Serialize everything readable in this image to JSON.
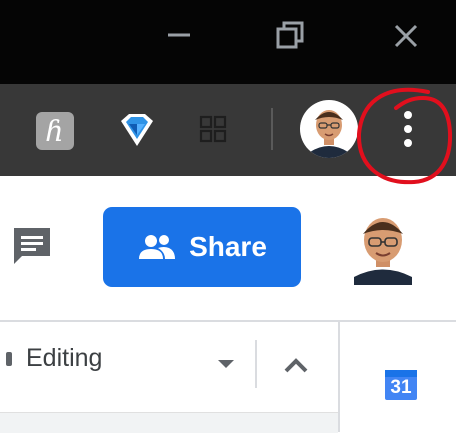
{
  "browser": {
    "window_controls": [
      "minimize",
      "restore",
      "close"
    ],
    "extensions": [
      {
        "name": "h-extension",
        "glyph": "ɦ"
      },
      {
        "name": "gem-extension"
      },
      {
        "name": "grid-extension"
      }
    ],
    "profile_avatar": "memoji-avatar",
    "menu_icon": "three-dots-vertical-icon"
  },
  "docs": {
    "share_label": "Share",
    "mode_label": "Editing",
    "calendar_day": "31"
  },
  "colors": {
    "title_bar": "#050505",
    "toolbar": "#383838",
    "share_blue": "#1a73e8",
    "annotation_red": "#e10f1d"
  }
}
